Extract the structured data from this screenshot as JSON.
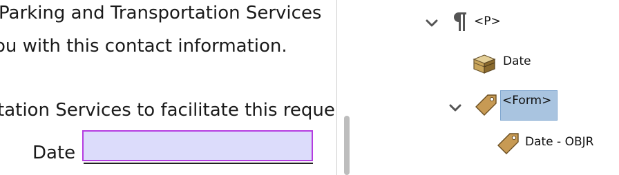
{
  "document": {
    "line1": "Parking and Transportation Services",
    "line2": "ou with this contact information.",
    "line3": "tation Services to facilitate this reque",
    "date_label": "Date",
    "date_field_value": ""
  },
  "tags_tree": {
    "p_tag": "<P>",
    "date_container": "Date",
    "form_tag": "<Form>",
    "form_child": "Date - OBJR"
  },
  "icons": {
    "paragraph": "pilcrow-icon",
    "container": "box-icon",
    "tag": "tag-icon",
    "expand": "chevron-down-icon"
  },
  "colors": {
    "field_fill": "#dcdcfb",
    "field_border": "#b43ce0",
    "selection": "#a9c4e0"
  }
}
